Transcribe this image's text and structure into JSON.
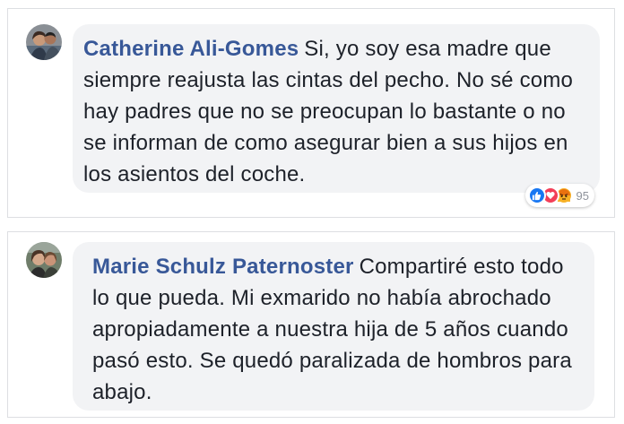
{
  "comments": [
    {
      "author": "Catherine Ali-Gomes",
      "text": "Si, yo soy esa madre que siempre reajusta las cintas del pecho. No  sé como hay padres que no se preocupan lo bas­tante o no se informan de como asegurar bien a sus hijos en los asientos del coche.",
      "reactions": {
        "icons": [
          "like-icon",
          "love-icon",
          "angry-icon"
        ],
        "count": "95"
      }
    },
    {
      "author": "Marie Schulz Paternoster",
      "text": "Compartiré esto todo lo que pueda. Mi exmarido no había abrochado apropiadamente a nuestra hija de 5 años cuando pasó esto. Se quedó paralizada de hombros para abajo."
    }
  ],
  "colors": {
    "author": "#385898",
    "bubble": "#f2f3f5",
    "text": "#1d2129",
    "like": "#1877f2",
    "love": "#f33e58",
    "angry": "#f7b125"
  }
}
